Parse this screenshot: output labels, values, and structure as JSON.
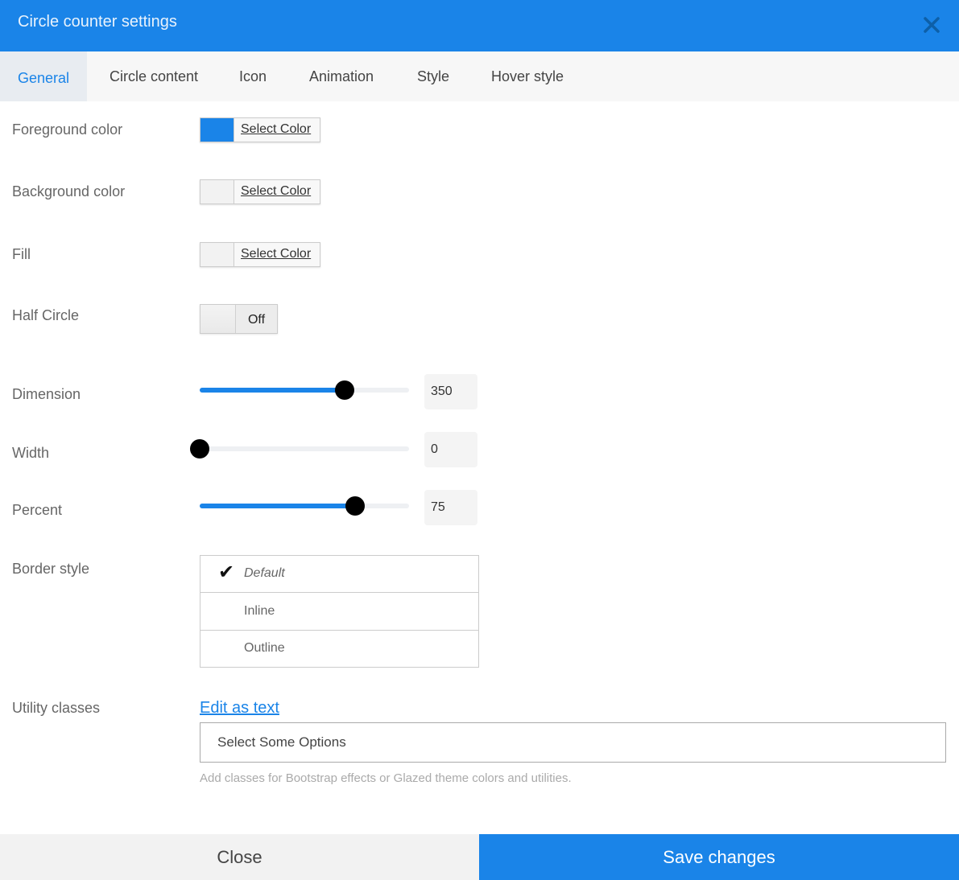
{
  "dialog": {
    "title": "Circle counter settings",
    "close_icon": "close-icon"
  },
  "tabs": [
    {
      "label": "General",
      "active": true
    },
    {
      "label": "Circle content",
      "active": false
    },
    {
      "label": "Icon",
      "active": false
    },
    {
      "label": "Animation",
      "active": false
    },
    {
      "label": "Style",
      "active": false
    },
    {
      "label": "Hover style",
      "active": false
    }
  ],
  "fields": {
    "foreground": {
      "label": "Foreground color",
      "button": "Select Color",
      "swatch": "#1a84e8"
    },
    "background": {
      "label": "Background color",
      "button": "Select Color",
      "swatch": "#f2f2f2"
    },
    "fill": {
      "label": "Fill",
      "button": "Select Color",
      "swatch": "#f2f2f2"
    },
    "half_circle": {
      "label": "Half Circle",
      "state": "Off"
    },
    "dimension": {
      "label": "Dimension",
      "value": "350",
      "level": 0.7
    },
    "width": {
      "label": "Width",
      "value": "0",
      "level": 0.0
    },
    "percent": {
      "label": "Percent",
      "value": "75",
      "level": 0.75
    },
    "border_style": {
      "label": "Border style",
      "options": [
        {
          "label": "Default",
          "selected": true
        },
        {
          "label": "Inline",
          "selected": false
        },
        {
          "label": "Outline",
          "selected": false
        }
      ]
    },
    "utility_classes": {
      "label": "Utility classes",
      "edit_link": "Edit as text",
      "placeholder": "Select Some Options",
      "help": "Add classes for Bootstrap effects or Glazed theme colors and utilities."
    }
  },
  "footer": {
    "close_label": "Close",
    "save_label": "Save changes"
  },
  "colors": {
    "accent": "#1a84e8",
    "slider_thumb": "#000000"
  }
}
